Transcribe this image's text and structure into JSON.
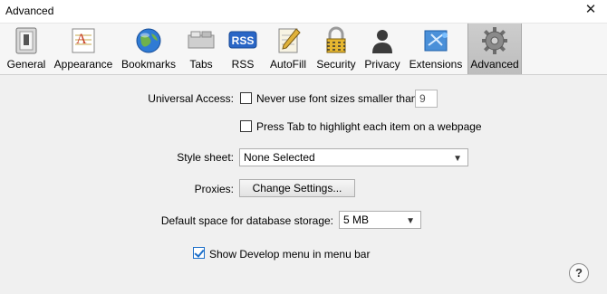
{
  "window": {
    "title": "Advanced",
    "close_glyph": "✕"
  },
  "toolbar": {
    "tabs": [
      {
        "id": "general",
        "label": "General",
        "icon": "switch-icon"
      },
      {
        "id": "appearance",
        "label": "Appearance",
        "icon": "font-icon"
      },
      {
        "id": "bookmarks",
        "label": "Bookmarks",
        "icon": "globe-icon"
      },
      {
        "id": "tabs",
        "label": "Tabs",
        "icon": "tabs-icon"
      },
      {
        "id": "rss",
        "label": "RSS",
        "icon": "rss-icon",
        "icon_text": "RSS"
      },
      {
        "id": "autofill",
        "label": "AutoFill",
        "icon": "pen-notepad-icon"
      },
      {
        "id": "security",
        "label": "Security",
        "icon": "lock-icon"
      },
      {
        "id": "privacy",
        "label": "Privacy",
        "icon": "person-icon"
      },
      {
        "id": "extensions",
        "label": "Extensions",
        "icon": "puzzle-icon"
      },
      {
        "id": "advanced",
        "label": "Advanced",
        "icon": "gear-icon",
        "active": true
      }
    ]
  },
  "settings": {
    "universal_access": {
      "label": "Universal Access:",
      "min_font_label": "Never use font sizes smaller than",
      "min_font_checked": false,
      "min_font_value": "9",
      "tab_highlight_label": "Press Tab to highlight each item on a webpage",
      "tab_highlight_checked": false
    },
    "style_sheet": {
      "label": "Style sheet:",
      "value": "None Selected"
    },
    "proxies": {
      "label": "Proxies:",
      "button": "Change Settings..."
    },
    "database_storage": {
      "label": "Default space for database storage:",
      "value": "5 MB"
    },
    "develop_menu": {
      "label": "Show Develop menu in menu bar",
      "checked": true
    }
  },
  "help": {
    "glyph": "?"
  },
  "colors": {
    "accent": "#1c6fc9",
    "rss_blue": "#2a66c6"
  }
}
